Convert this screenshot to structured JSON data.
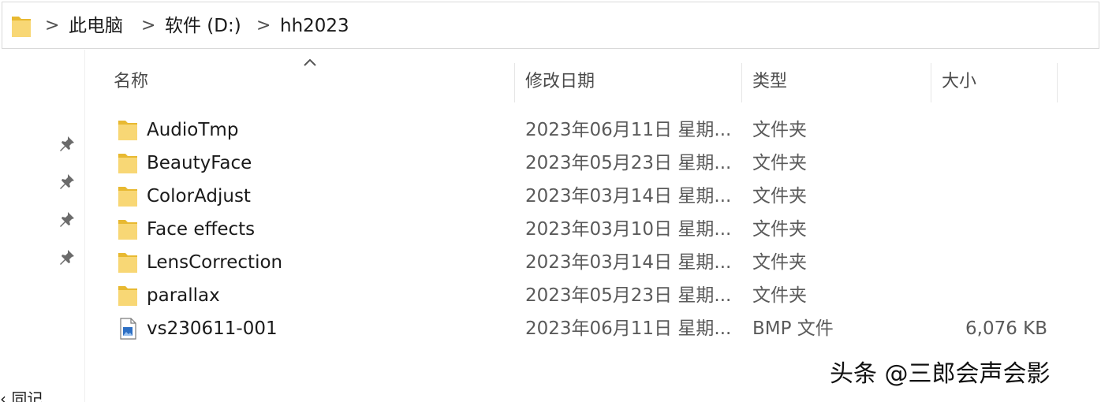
{
  "breadcrumb": {
    "items": [
      "此电脑",
      "软件 (D:)",
      "hh2023"
    ],
    "separator": ">"
  },
  "columns": {
    "name": "名称",
    "date": "修改日期",
    "type": "类型",
    "size": "大小"
  },
  "sort": {
    "column": "name",
    "direction": "ascending"
  },
  "files": [
    {
      "name": "AudioTmp",
      "date": "2023年06月11日 星期...",
      "type": "文件夹",
      "size": "",
      "icon": "folder-icon"
    },
    {
      "name": "BeautyFace",
      "date": "2023年05月23日 星期...",
      "type": "文件夹",
      "size": "",
      "icon": "folder-icon"
    },
    {
      "name": "ColorAdjust",
      "date": "2023年03月14日 星期...",
      "type": "文件夹",
      "size": "",
      "icon": "folder-icon"
    },
    {
      "name": "Face effects",
      "date": "2023年03月10日 星期...",
      "type": "文件夹",
      "size": "",
      "icon": "folder-icon"
    },
    {
      "name": "LensCorrection",
      "date": "2023年03月14日 星期...",
      "type": "文件夹",
      "size": "",
      "icon": "folder-icon"
    },
    {
      "name": "parallax",
      "date": "2023年05月23日 星期...",
      "type": "文件夹",
      "size": "",
      "icon": "folder-icon"
    },
    {
      "name": "vs230611-001",
      "date": "2023年06月11日 星期...",
      "type": "BMP 文件",
      "size": "6,076 KB",
      "icon": "bmp-file-icon"
    }
  ],
  "nav": {
    "partial_label": "‹ 同记"
  },
  "watermark": "头条 @三郎会声会影",
  "colors": {
    "folder": "#f8d775",
    "folder_dark": "#e8b931",
    "header_text": "#4a4a4a",
    "secondary_text": "#5a5a5a"
  }
}
